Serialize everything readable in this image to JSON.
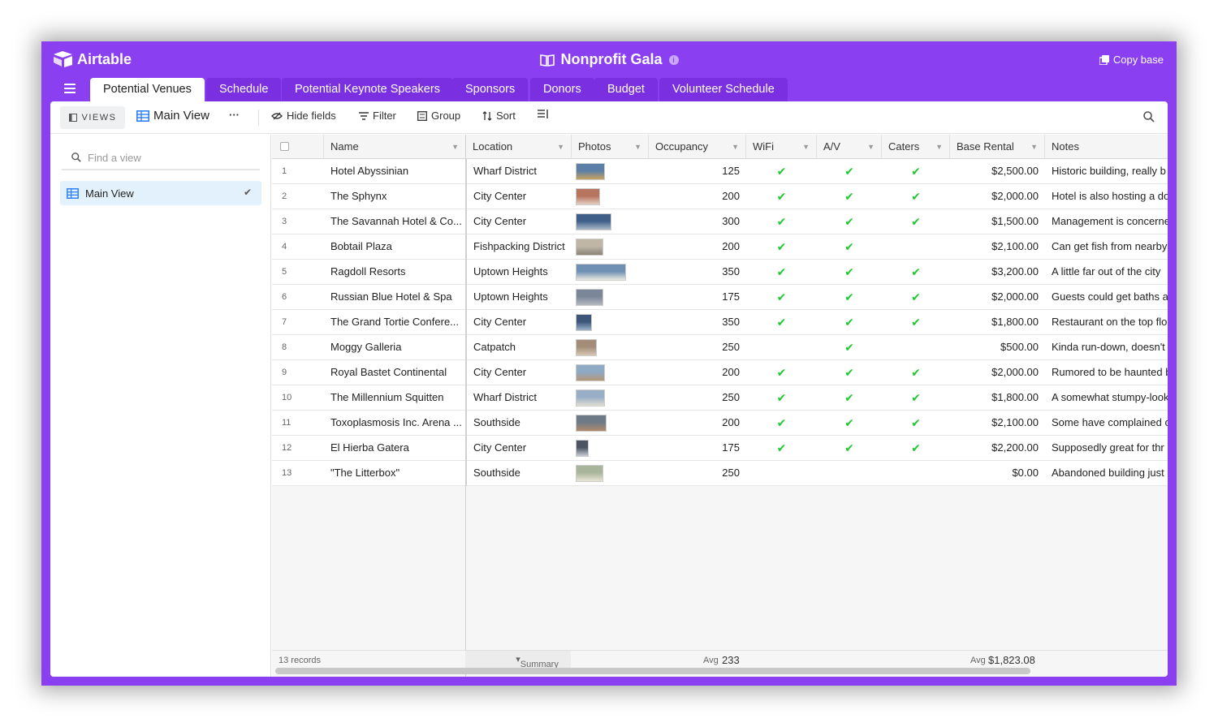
{
  "app": {
    "brand": "Airtable",
    "base_title": "Nonprofit Gala",
    "copy_base": "Copy base"
  },
  "tabs": [
    "Potential Venues",
    "Schedule",
    "Potential Keynote Speakers",
    "Sponsors",
    "Donors",
    "Budget",
    "Volunteer Schedule"
  ],
  "toolbar": {
    "views": "VIEWS",
    "main_view": "Main View",
    "more": "···",
    "hide_fields": "Hide fields",
    "filter": "Filter",
    "group": "Group",
    "sort": "Sort"
  },
  "sidebar": {
    "find_placeholder": "Find a view",
    "view_name": "Main View"
  },
  "columns": [
    "Name",
    "Location",
    "Photos",
    "Occupancy",
    "WiFi",
    "A/V",
    "Caters",
    "Base Rental",
    "Notes"
  ],
  "rows": [
    {
      "n": "1",
      "name": "Hotel Abyssinian",
      "location": "Wharf District",
      "occ": "125",
      "wifi": true,
      "av": true,
      "caters": true,
      "rental": "$2,500.00",
      "notes": "Historic building, really b"
    },
    {
      "n": "2",
      "name": "The Sphynx",
      "location": "City Center",
      "occ": "200",
      "wifi": true,
      "av": true,
      "caters": true,
      "rental": "$2,000.00",
      "notes": "Hotel is also hosting a do"
    },
    {
      "n": "3",
      "name": "The Savannah Hotel & Co...",
      "location": "City Center",
      "occ": "300",
      "wifi": true,
      "av": true,
      "caters": true,
      "rental": "$1,500.00",
      "notes": "Management is concerne"
    },
    {
      "n": "4",
      "name": "Bobtail Plaza",
      "location": "Fishpacking District",
      "occ": "200",
      "wifi": true,
      "av": true,
      "caters": false,
      "rental": "$2,100.00",
      "notes": "Can get fish from nearby"
    },
    {
      "n": "5",
      "name": "Ragdoll Resorts",
      "location": "Uptown Heights",
      "occ": "350",
      "wifi": true,
      "av": true,
      "caters": true,
      "rental": "$3,200.00",
      "notes": "A little far out of the city"
    },
    {
      "n": "6",
      "name": "Russian Blue Hotel & Spa",
      "location": "Uptown Heights",
      "occ": "175",
      "wifi": true,
      "av": true,
      "caters": true,
      "rental": "$2,000.00",
      "notes": "Guests could get baths a"
    },
    {
      "n": "7",
      "name": "The Grand Tortie Confere...",
      "location": "City Center",
      "occ": "350",
      "wifi": true,
      "av": true,
      "caters": true,
      "rental": "$1,800.00",
      "notes": "Restaurant on the top flo"
    },
    {
      "n": "8",
      "name": "Moggy Galleria",
      "location": "Catpatch",
      "occ": "250",
      "wifi": false,
      "av": true,
      "caters": false,
      "rental": "$500.00",
      "notes": "Kinda run-down, doesn't"
    },
    {
      "n": "9",
      "name": "Royal Bastet Continental",
      "location": "City Center",
      "occ": "200",
      "wifi": true,
      "av": true,
      "caters": true,
      "rental": "$2,000.00",
      "notes": "Rumored to be haunted b"
    },
    {
      "n": "10",
      "name": "The Millennium Squitten",
      "location": "Wharf District",
      "occ": "250",
      "wifi": true,
      "av": true,
      "caters": true,
      "rental": "$1,800.00",
      "notes": "A somewhat stumpy-look"
    },
    {
      "n": "11",
      "name": "Toxoplasmosis Inc. Arena ...",
      "location": "Southside",
      "occ": "200",
      "wifi": true,
      "av": true,
      "caters": true,
      "rental": "$2,100.00",
      "notes": "Some have complained o"
    },
    {
      "n": "12",
      "name": "El Hierba Gatera",
      "location": "City Center",
      "occ": "175",
      "wifi": true,
      "av": true,
      "caters": true,
      "rental": "$2,200.00",
      "notes": "Supposedly great for thr"
    },
    {
      "n": "13",
      "name": "\"The Litterbox\"",
      "location": "Southside",
      "occ": "250",
      "wifi": false,
      "av": false,
      "caters": false,
      "rental": "$0.00",
      "notes": "Abandoned building just"
    }
  ],
  "footer": {
    "records": "13 records",
    "summary": "Summary",
    "avg_occ_label": "Avg",
    "avg_occ": "233",
    "avg_rental_label": "Avg",
    "avg_rental": "$1,823.08"
  },
  "colors": {
    "brand_purple": "#8a3ff0",
    "check_green": "#20c933"
  }
}
